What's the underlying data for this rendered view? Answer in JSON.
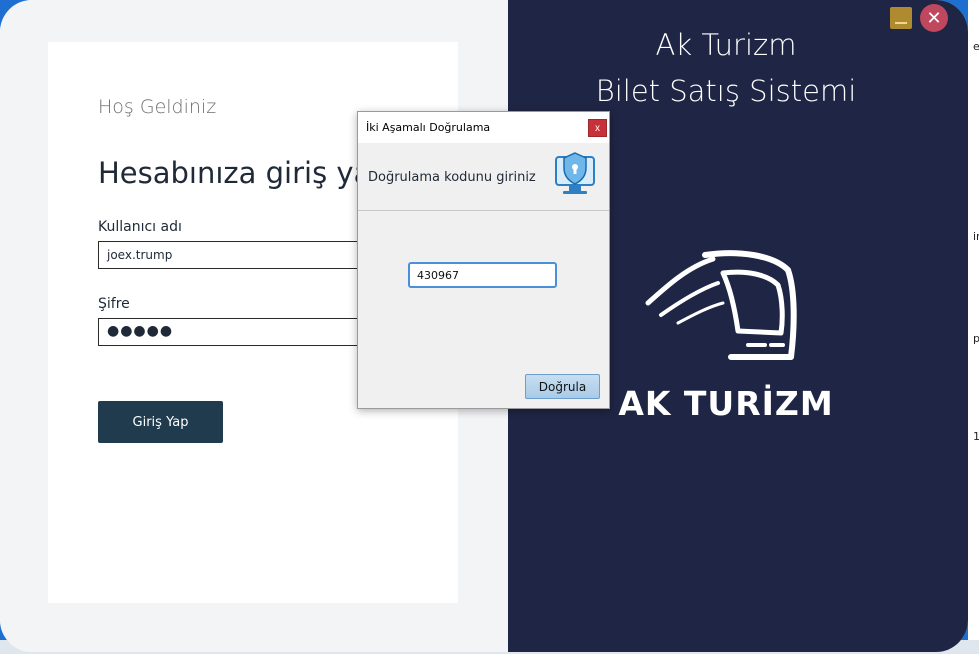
{
  "left": {
    "welcome": "Hoş Geldiniz",
    "heading": "Hesabınıza giriş yap",
    "username_label": "Kullanıcı adı",
    "username_value": "joex.trump",
    "password_label": "Şifre",
    "password_value": "●●●●●",
    "login_button": "Giriş Yap"
  },
  "right": {
    "title_line1": "Ak Turizm",
    "title_line2": "Bilet Satış Sistemi",
    "logo_text": "AK TURİZM",
    "close_symbol": "✕"
  },
  "dialog": {
    "title": "İki Aşamalı Doğrulama",
    "close_symbol": "x",
    "prompt": "Doğrulama kodunu giriniz",
    "code_value": "430967",
    "verify_button": "Doğrula"
  },
  "colors": {
    "brand_navy": "#1f2544",
    "login_button": "#1f3b4d",
    "minimize": "#b08a2e",
    "close": "#c0485e"
  },
  "icons": [
    "bus-icon",
    "shield-monitor-icon",
    "minimize-icon",
    "close-icon"
  ]
}
